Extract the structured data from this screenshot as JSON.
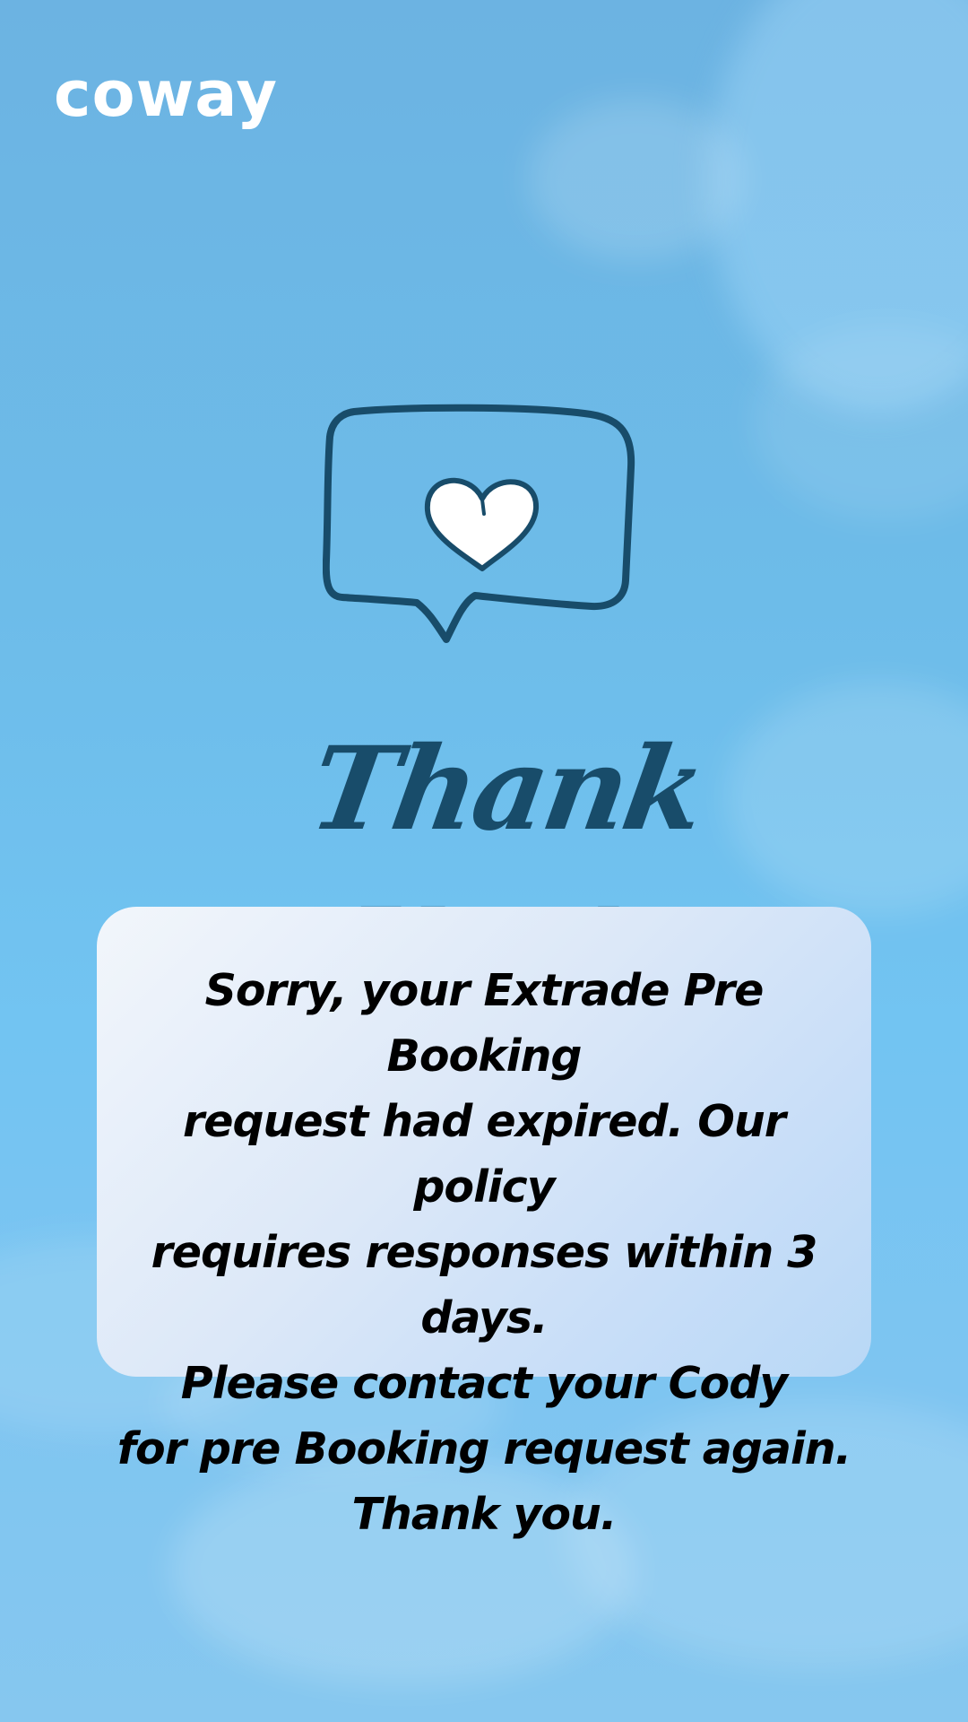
{
  "brand": {
    "logo_text": "coway"
  },
  "hero": {
    "icon": "heart-speech-bubble-icon",
    "heading": "Thank You!"
  },
  "message": {
    "lines": [
      "Sorry, your Extrade Pre Booking",
      "request had expired. Our policy",
      "requires responses within 3 days.",
      "Please contact your Cody",
      "for pre Booking request again.",
      "Thank you."
    ]
  },
  "colors": {
    "sky": "#6dbce9",
    "accent": "#184c6a",
    "card": "#dce8f8",
    "logo": "#ffffff"
  }
}
